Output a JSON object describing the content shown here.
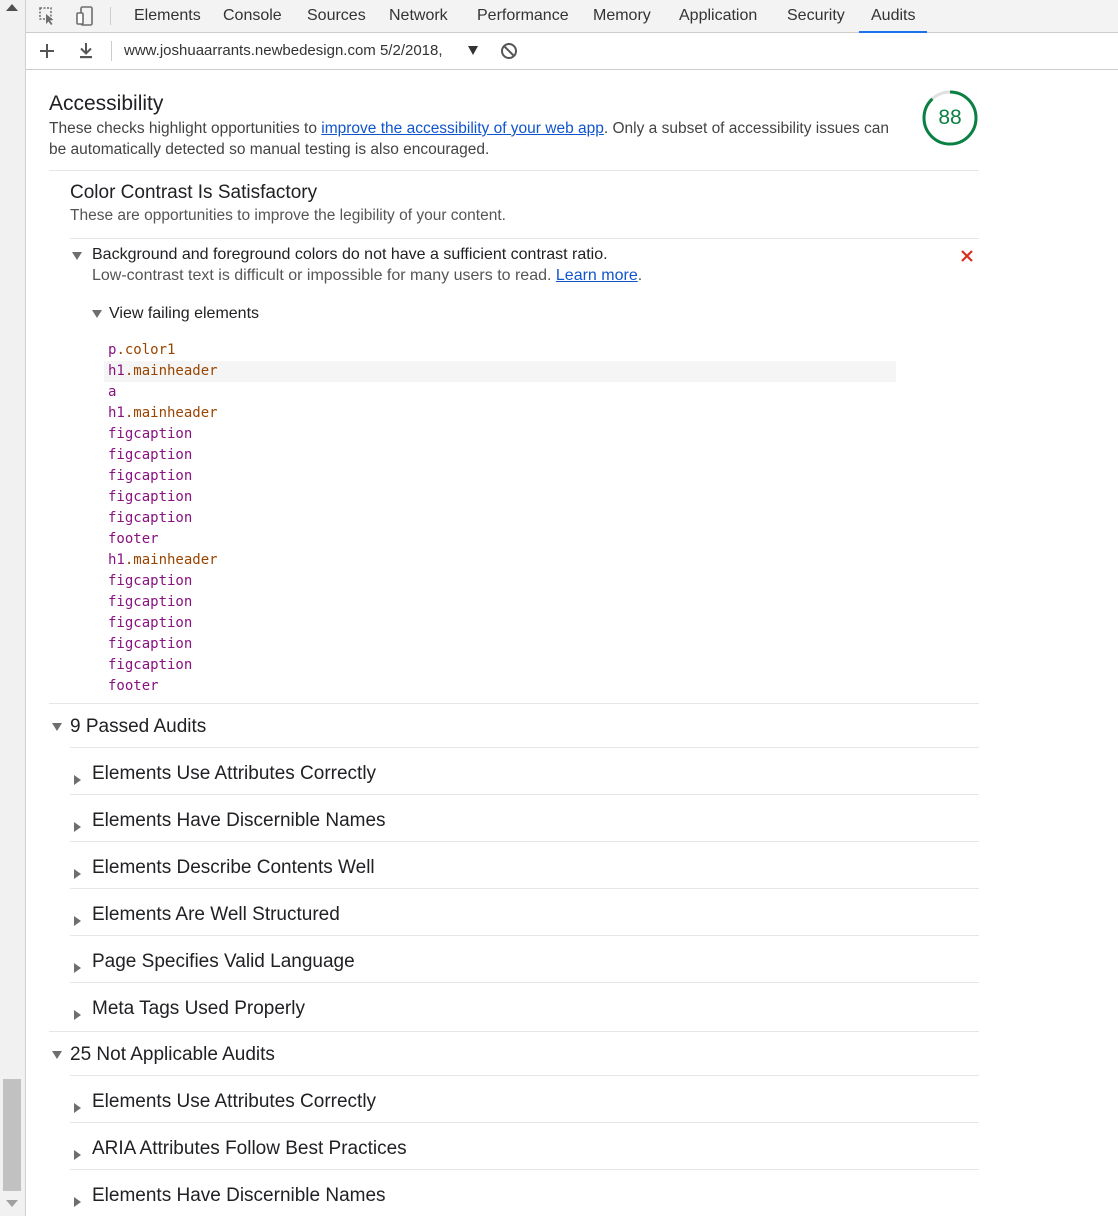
{
  "devtools": {
    "tabs": [
      "Elements",
      "Console",
      "Sources",
      "Network",
      "Performance",
      "Memory",
      "Application",
      "Security",
      "Audits"
    ],
    "active_tab": "Audits",
    "accent_color": "#1a73e8"
  },
  "toolbar": {
    "report_label": "www.joshuaarrants.newbedesign.com 5/2/2018,"
  },
  "category": {
    "title": "Accessibility",
    "desc_before": "These checks highlight opportunities to ",
    "desc_link": "improve the accessibility of your web app",
    "desc_after": ". Only a subset of accessibility issues can be automatically detected so manual testing is also encouraged.",
    "score": "88",
    "score_color": "#0b8043"
  },
  "group": {
    "title": "Color Contrast Is Satisfactory",
    "desc": "These are opportunities to improve the legibility of your content."
  },
  "failed_audit": {
    "title": "Background and foreground colors do not have a sufficient contrast ratio.",
    "desc": "Low-contrast text is difficult or impossible for many users to read. ",
    "learn_more": "Learn more",
    "desc_end": ".",
    "fail_color": "#d93025",
    "view_failing_label": "View failing elements",
    "elements": [
      {
        "tag": "p",
        "cls": ".color1"
      },
      {
        "tag": "h1",
        "cls": ".mainheader"
      },
      {
        "tag": "a",
        "cls": ""
      },
      {
        "tag": "h1",
        "cls": ".mainheader"
      },
      {
        "tag": "figcaption",
        "cls": ""
      },
      {
        "tag": "figcaption",
        "cls": ""
      },
      {
        "tag": "figcaption",
        "cls": ""
      },
      {
        "tag": "figcaption",
        "cls": ""
      },
      {
        "tag": "figcaption",
        "cls": ""
      },
      {
        "tag": "footer",
        "cls": ""
      },
      {
        "tag": "h1",
        "cls": ".mainheader"
      },
      {
        "tag": "figcaption",
        "cls": ""
      },
      {
        "tag": "figcaption",
        "cls": ""
      },
      {
        "tag": "figcaption",
        "cls": ""
      },
      {
        "tag": "figcaption",
        "cls": ""
      },
      {
        "tag": "figcaption",
        "cls": ""
      },
      {
        "tag": "footer",
        "cls": ""
      }
    ]
  },
  "passed": {
    "title": "9 Passed Audits",
    "items": [
      "Elements Use Attributes Correctly",
      "Elements Have Discernible Names",
      "Elements Describe Contents Well",
      "Elements Are Well Structured",
      "Page Specifies Valid Language",
      "Meta Tags Used Properly"
    ]
  },
  "not_applicable": {
    "title": "25 Not Applicable Audits",
    "items": [
      "Elements Use Attributes Correctly",
      "ARIA Attributes Follow Best Practices",
      "Elements Have Discernible Names"
    ]
  }
}
